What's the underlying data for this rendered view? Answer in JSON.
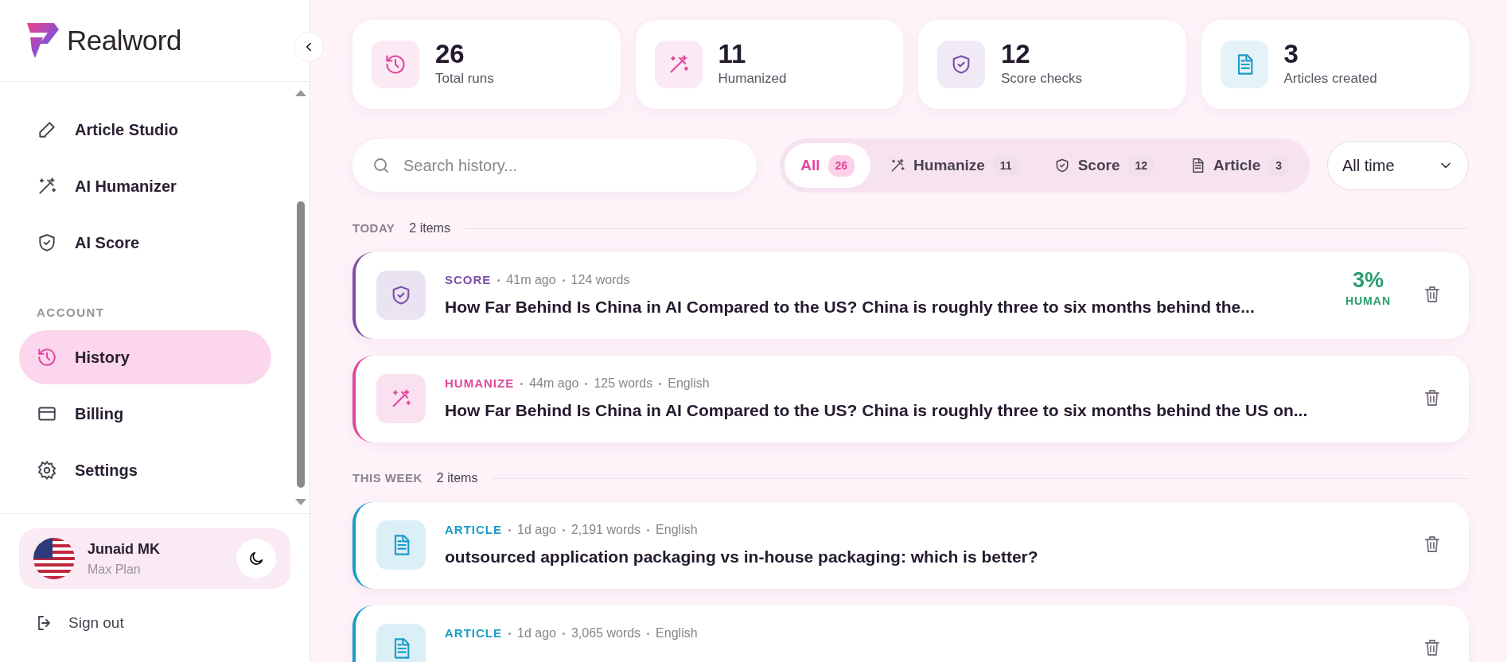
{
  "brand": {
    "name": "Realword"
  },
  "sidebar": {
    "items": [
      {
        "label": "Article Studio",
        "selected": false
      },
      {
        "label": "AI Humanizer",
        "selected": false
      },
      {
        "label": "AI Score",
        "selected": false
      }
    ],
    "section_label": "ACCOUNT",
    "account_items": [
      {
        "label": "History",
        "selected": true
      },
      {
        "label": "Billing",
        "selected": false
      },
      {
        "label": "Settings",
        "selected": false
      }
    ],
    "user": {
      "name": "Junaid MK",
      "plan": "Max Plan"
    },
    "sign_out": "Sign out"
  },
  "stats": [
    {
      "value": "26",
      "label": "Total runs",
      "color": "#e0479e"
    },
    {
      "value": "11",
      "label": "Humanized",
      "color": "#e0479e"
    },
    {
      "value": "12",
      "label": "Score checks",
      "color": "#7b4fa8"
    },
    {
      "value": "3",
      "label": "Articles created",
      "color": "#1a9bc9"
    }
  ],
  "search": {
    "placeholder": "Search history..."
  },
  "filters": [
    {
      "label": "All",
      "count": "26",
      "selected": true
    },
    {
      "label": "Humanize",
      "count": "11",
      "selected": false
    },
    {
      "label": "Score",
      "count": "12",
      "selected": false
    },
    {
      "label": "Article",
      "count": "3",
      "selected": false
    }
  ],
  "period": {
    "value": "All time"
  },
  "groups": [
    {
      "title": "TODAY",
      "count": "2 items",
      "items": [
        {
          "kind": "score",
          "type": "SCORE",
          "meta": [
            "41m ago",
            "124 words"
          ],
          "title": "How Far Behind Is China in AI Compared to the US? China is roughly three to six months behind the...",
          "result": "3%",
          "result_label": "HUMAN",
          "color": "#7b4fa8"
        },
        {
          "kind": "humanize",
          "type": "HUMANIZE",
          "meta": [
            "44m ago",
            "125 words",
            "English"
          ],
          "title": "How Far Behind Is China in AI Compared to the US? China is roughly three to six months behind the US on...",
          "color": "#e0479e"
        }
      ]
    },
    {
      "title": "THIS WEEK",
      "count": "2 items",
      "items": [
        {
          "kind": "article",
          "type": "ARTICLE",
          "meta": [
            "1d ago",
            "2,191 words",
            "English"
          ],
          "title": "outsourced application packaging vs in-house packaging: which is better?",
          "color": "#1a9bc9"
        },
        {
          "kind": "article",
          "type": "ARTICLE",
          "meta": [
            "1d ago",
            "3,065 words",
            "English"
          ],
          "color": "#1a9bc9"
        }
      ]
    }
  ]
}
